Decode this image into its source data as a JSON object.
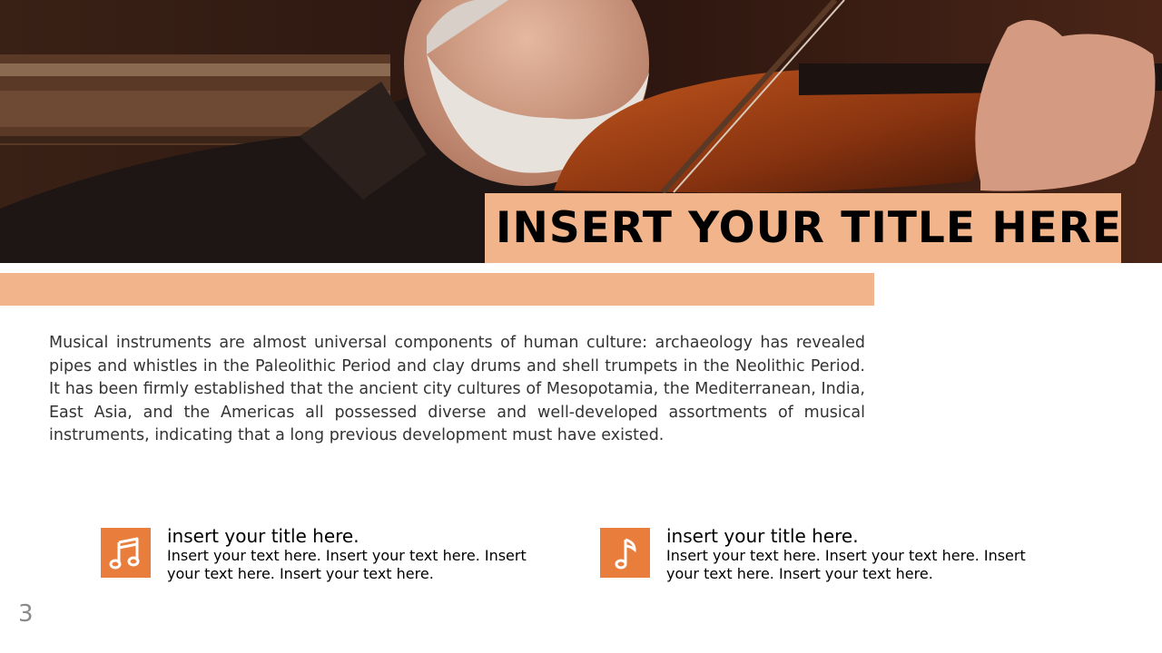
{
  "slide": {
    "title": "INSERT YOUR TITLE HERE",
    "body": "Musical instruments are almost universal components of human culture: archaeology has revealed pipes and whistles in the Paleolithic Period and clay drums and shell trumpets in the Neolithic Period. It has been firmly established that the ancient city cultures of Mesopotamia, the Mediterranean, India, East Asia, and the Americas all possessed diverse and well-developed assortments of musical instruments, indicating that a long previous development must have existed.",
    "page_number": "3",
    "accent_color": "#f2b48a",
    "icon_color": "#e97d3c"
  },
  "features": [
    {
      "icon": "double-music-note-icon",
      "title": "insert your title here.",
      "text": "Insert your text here. Insert your text here. Insert your text here. Insert your text here."
    },
    {
      "icon": "single-music-note-icon",
      "title": "insert your title here.",
      "text": "Insert your text here. Insert your text here. Insert your text here. Insert your text here."
    }
  ]
}
